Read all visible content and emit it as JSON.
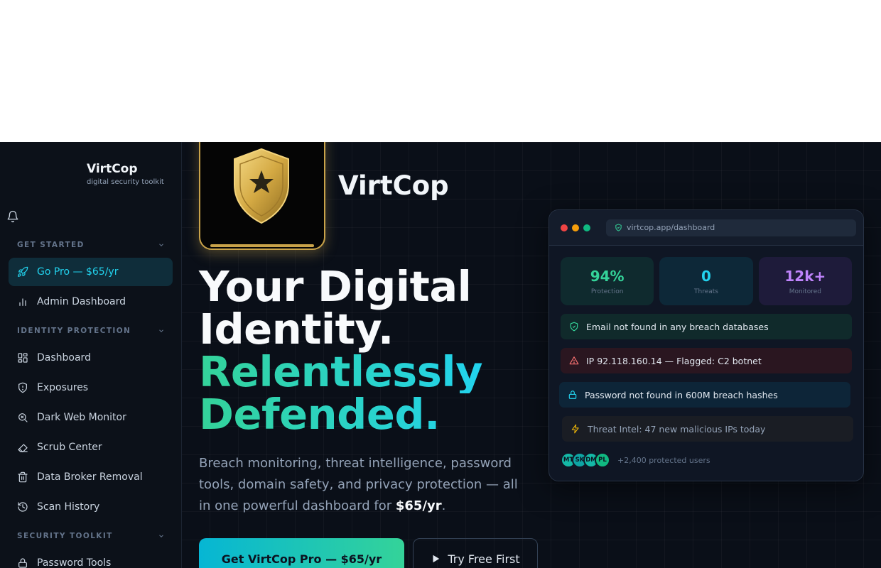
{
  "sidebar": {
    "brand": {
      "name": "VirtCop",
      "tagline": "digital security toolkit"
    },
    "sections": [
      {
        "label": "GET STARTED"
      },
      {
        "label": "IDENTITY PROTECTION"
      },
      {
        "label": "SECURITY TOOLKIT"
      }
    ],
    "items": [
      {
        "label": "Go Pro — $65/yr",
        "icon": "rocket-icon",
        "active": true
      },
      {
        "label": "Admin Dashboard",
        "icon": "bar-chart-icon"
      },
      {
        "label": "Dashboard",
        "icon": "grid-icon"
      },
      {
        "label": "Exposures",
        "icon": "shield-icon"
      },
      {
        "label": "Dark Web Monitor",
        "icon": "search-icon"
      },
      {
        "label": "Scrub Center",
        "icon": "eraser-icon"
      },
      {
        "label": "Data Broker Removal",
        "icon": "trash-icon"
      },
      {
        "label": "Scan History",
        "icon": "history-icon"
      },
      {
        "label": "Password Tools",
        "icon": "lock-icon"
      }
    ]
  },
  "hero": {
    "brand": "VirtCop",
    "headline_line1": "Your Digital",
    "headline_line2": "Identity.",
    "headline_line3": "Relentlessly",
    "headline_line4": "Defended.",
    "description": "Breach monitoring, threat intelligence, password tools, domain safety, and privacy protection — all in one powerful dashboard for ",
    "price": "$65/yr",
    "description_end": ".",
    "cta_primary": "Get VirtCop Pro — $65/yr",
    "cta_secondary": "Try Free First"
  },
  "preview": {
    "url": "virtcop.app/dashboard",
    "stats": [
      {
        "value": "94%",
        "label": "Protection",
        "color": "#34d399"
      },
      {
        "value": "0",
        "label": "Threats",
        "color": "#22d3ee"
      },
      {
        "value": "12k+",
        "label": "Monitored",
        "color": "#c084fc"
      }
    ],
    "alerts": [
      {
        "text": "Email not found in any breach databases",
        "icon": "shield-check-icon"
      },
      {
        "text": "IP 92.118.160.14 — Flagged: C2 botnet",
        "icon": "warning-icon"
      },
      {
        "text": "Password not found in 600M breach hashes",
        "icon": "lock-icon"
      },
      {
        "text": "Threat Intel: 47 new malicious IPs today",
        "icon": "lightning-icon"
      }
    ],
    "avatars": [
      "MT",
      "SK",
      "DM",
      "PL"
    ],
    "users_text": "+2,400 protected users"
  },
  "colors": {
    "accent": "#22d3ee",
    "green": "#34d399",
    "gold": "#c9a34a",
    "background": "#0a0f18"
  }
}
